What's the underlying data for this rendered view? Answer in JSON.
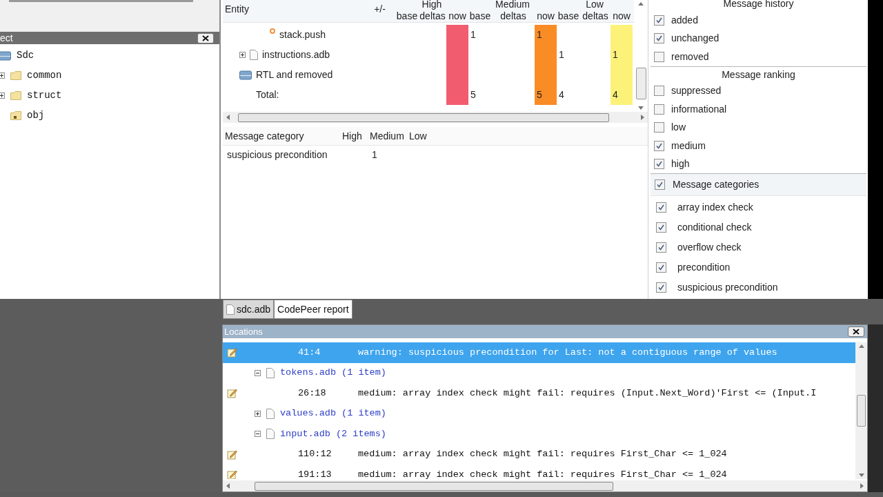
{
  "project_panel": {
    "title": "ect",
    "tree": [
      {
        "label": "Sdc",
        "kind": "project",
        "children": [
          {
            "label": "common",
            "kind": "folder",
            "expanded": false
          },
          {
            "label": "struct",
            "kind": "folder",
            "expanded": false
          },
          {
            "label": "obj",
            "kind": "locked-folder"
          }
        ]
      }
    ]
  },
  "summary_table": {
    "entity_header": "Entity",
    "delta_header": "+/-",
    "groups": [
      {
        "label": "High",
        "subcolumns": [
          "base",
          "deltas",
          "now"
        ],
        "color": "#f25c6f"
      },
      {
        "label": "Medium",
        "subcolumns": [
          "base",
          "deltas",
          "now"
        ],
        "color": "#f98c25"
      },
      {
        "label": "Low",
        "subcolumns": [
          "base",
          "deltas",
          "now"
        ],
        "color": "#fcf27a"
      }
    ],
    "rows": [
      {
        "entity": "stack.push",
        "kind": "subprogram",
        "cells": [
          "",
          "",
          "",
          "1",
          "",
          "1",
          "",
          "",
          ""
        ]
      },
      {
        "entity": "instructions.adb",
        "kind": "file",
        "expanded": false,
        "cells": [
          "",
          "",
          "",
          "",
          "",
          "",
          "1",
          "",
          "1"
        ]
      },
      {
        "entity": "RTL and removed",
        "kind": "group",
        "cells": [
          "",
          "",
          "",
          "",
          "",
          "",
          "",
          "",
          ""
        ]
      },
      {
        "entity": "Total:",
        "kind": "total",
        "cells": [
          "",
          "",
          "",
          "5",
          "",
          "5",
          "4",
          "",
          "4"
        ]
      }
    ]
  },
  "category_table": {
    "columns": [
      "Message category",
      "High",
      "Medium",
      "Low"
    ],
    "rows": [
      [
        "suspicious precondition",
        "",
        "1",
        ""
      ]
    ]
  },
  "filters": {
    "sections": [
      {
        "title": "Message history",
        "kind": "plain",
        "items": [
          {
            "label": "added",
            "checked": true
          },
          {
            "label": "unchanged",
            "checked": true
          },
          {
            "label": "removed",
            "checked": false
          }
        ]
      },
      {
        "title": "Message ranking",
        "kind": "plain",
        "items": [
          {
            "label": "suppressed",
            "checked": false
          },
          {
            "label": "informational",
            "checked": false
          },
          {
            "label": "low",
            "checked": false
          },
          {
            "label": "medium",
            "checked": true
          },
          {
            "label": "high",
            "checked": true
          }
        ]
      },
      {
        "title": "Message categories",
        "kind": "checkable",
        "checked": true,
        "items": [
          {
            "label": "array index check",
            "checked": true
          },
          {
            "label": "conditional check",
            "checked": true
          },
          {
            "label": "overflow check",
            "checked": true
          },
          {
            "label": "precondition",
            "checked": true
          },
          {
            "label": "suspicious precondition",
            "checked": true
          }
        ]
      }
    ]
  },
  "editor_tabs": [
    {
      "label": "sdc.adb",
      "kind": "file",
      "selected": false
    },
    {
      "label": "CodePeer report",
      "kind": "plain",
      "selected": true
    }
  ],
  "locations": {
    "title": "Locations",
    "items": [
      {
        "kind": "message",
        "location": "41:4",
        "text": "warning: suspicious precondition for Last: not a contiguous range of values",
        "selected": true
      },
      {
        "kind": "file",
        "label": "tokens.adb (1 item)",
        "expanded": true,
        "children": [
          {
            "kind": "message",
            "location": "26:18",
            "text": "medium: array index check might fail: requires (Input.Next_Word)'First <= (Input.I",
            "selected": false
          }
        ]
      },
      {
        "kind": "file",
        "label": "values.adb (1 item)",
        "expanded": false
      },
      {
        "kind": "file",
        "label": "input.adb (2 items)",
        "expanded": true,
        "children": [
          {
            "kind": "message",
            "location": "110:12",
            "text": "medium: array index check might fail: requires First_Char <= 1_024",
            "selected": false
          },
          {
            "kind": "message",
            "location": "191:13",
            "text": "medium: array index check might fail: requires First_Char <= 1_024",
            "selected": false
          }
        ]
      }
    ]
  }
}
